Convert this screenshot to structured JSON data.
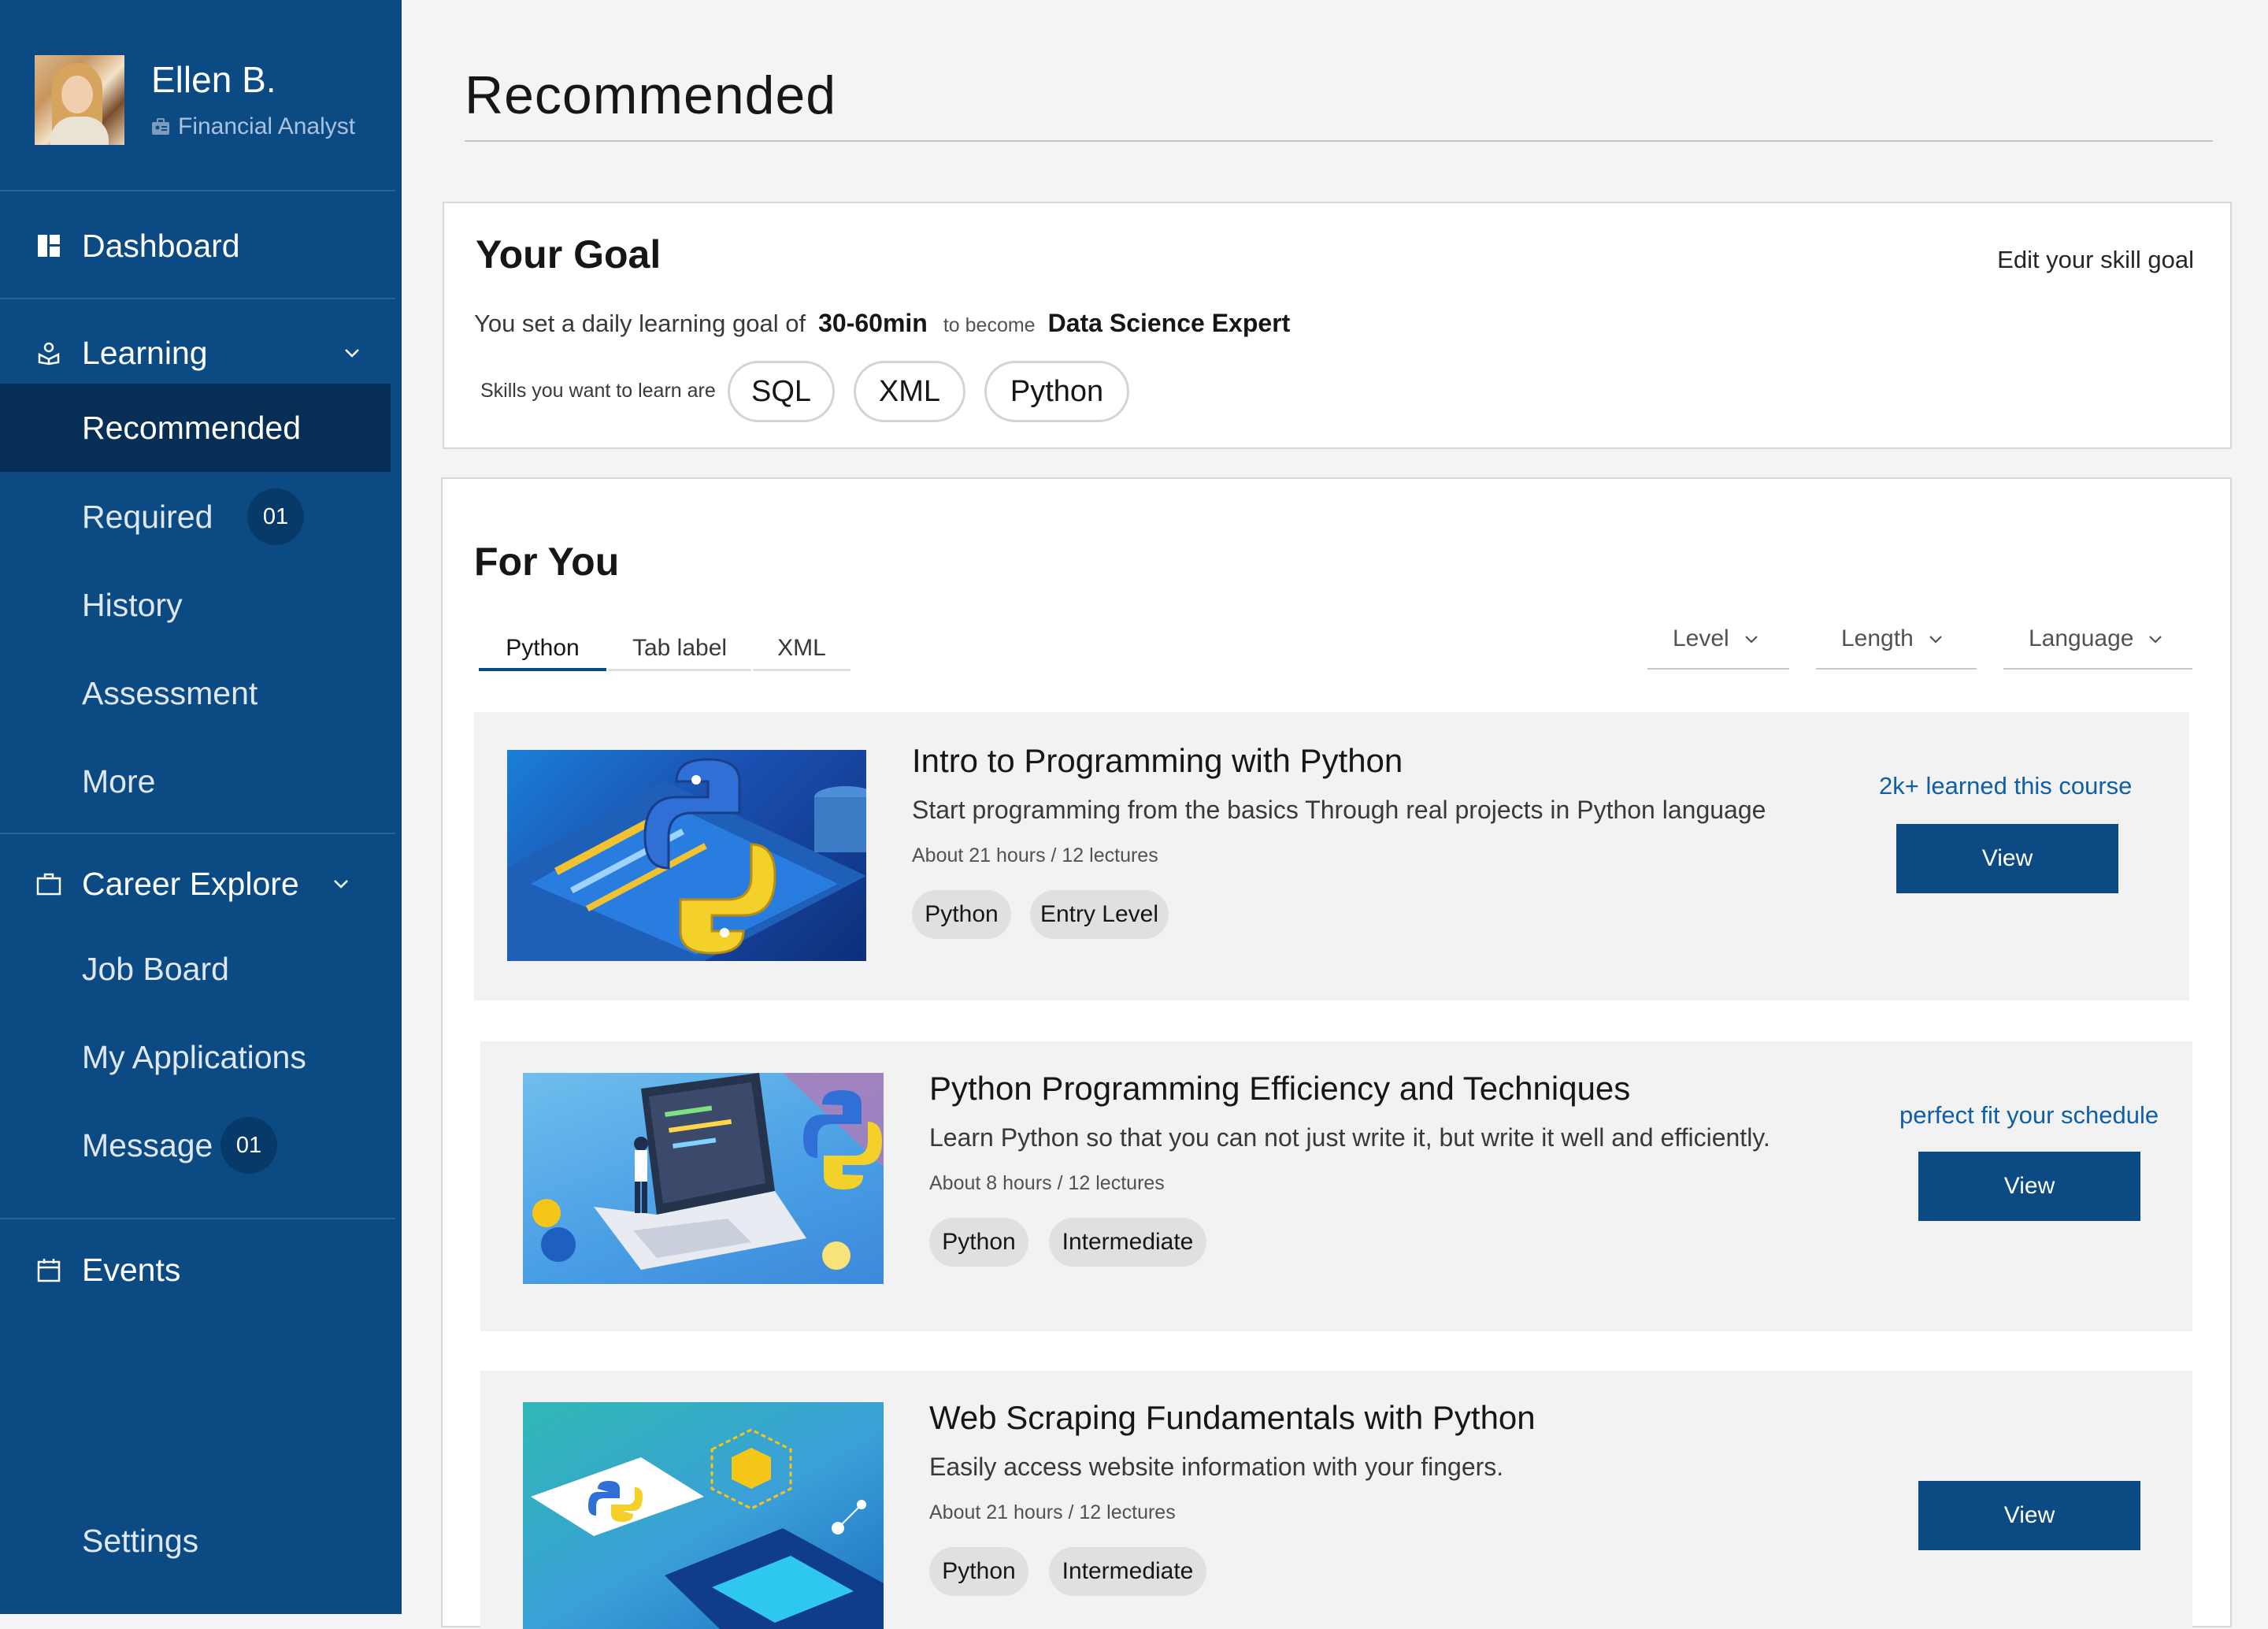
{
  "colors": {
    "sidebar": "#0b4a83",
    "sidebar_active": "#072f55",
    "accent": "#0b4a83",
    "link": "#0f5fa6",
    "page_bg": "#f4f4f6"
  },
  "profile": {
    "name": "Ellen B.",
    "role": "Financial Analyst",
    "role_icon": "id-badge-icon"
  },
  "sidebar": {
    "dashboard": {
      "label": "Dashboard",
      "icon": "dashboard-icon"
    },
    "learning": {
      "label": "Learning",
      "icon": "learning-icon",
      "expanded": true,
      "items": [
        {
          "label": "Recommended",
          "active": true
        },
        {
          "label": "Required",
          "count": "01"
        },
        {
          "label": "History"
        },
        {
          "label": "Assessment"
        },
        {
          "label": "More"
        }
      ]
    },
    "career": {
      "label": "Career Explore",
      "icon": "briefcase-icon",
      "expanded": true,
      "items": [
        {
          "label": "Job Board"
        },
        {
          "label": "My Applications"
        },
        {
          "label": "Message",
          "count": "01"
        }
      ]
    },
    "events": {
      "label": "Events",
      "icon": "calendar-icon"
    },
    "settings": {
      "label": "Settings"
    }
  },
  "main": {
    "title": "Recommended"
  },
  "goal": {
    "title": "Your Goal",
    "edit_link": "Edit your skill goal",
    "text_prefix": "You set a daily learning goal of",
    "duration": "30-60min",
    "text_middle": "to become",
    "target": "Data Science Expert",
    "skills_label": "Skills you want to learn are",
    "skills": [
      "SQL",
      "XML",
      "Python"
    ]
  },
  "for_you": {
    "title": "For You",
    "tabs": [
      {
        "label": "Python",
        "active": true
      },
      {
        "label": "Tab label",
        "active": false
      },
      {
        "label": "XML",
        "active": false
      }
    ],
    "filters": [
      {
        "label": "Level"
      },
      {
        "label": "Length"
      },
      {
        "label": "Language"
      }
    ],
    "courses": [
      {
        "title": "Intro to Programming with Python",
        "description": "Start programming from the basics Through real projects in Python language",
        "meta": "About 21 hours / 12 lectures",
        "tags": [
          "Python",
          "Entry Level"
        ],
        "note": "2k+ learned this course",
        "button": "View"
      },
      {
        "title": "Python Programming Efficiency and Techniques",
        "description": "Learn Python so that you can not just write it, but write it well and efficiently.",
        "meta": "About 8 hours / 12 lectures",
        "tags": [
          "Python",
          "Intermediate"
        ],
        "note": "perfect fit your schedule",
        "button": "View"
      },
      {
        "title": "Web Scraping Fundamentals with Python",
        "description": "Easily access website information with your fingers.",
        "meta": "About 21 hours / 12 lectures",
        "tags": [
          "Python",
          "Intermediate"
        ],
        "note": "",
        "button": "View"
      }
    ]
  }
}
